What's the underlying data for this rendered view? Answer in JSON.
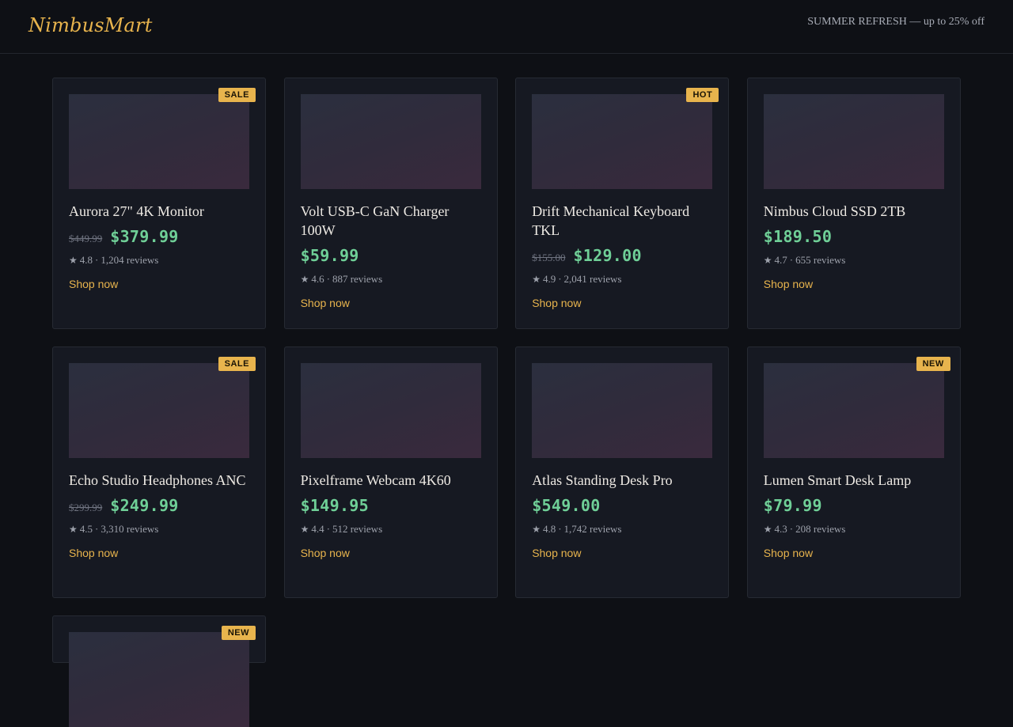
{
  "header": {
    "logo": "NimbusMart",
    "promo": "SUMMER REFRESH — up to 25% off"
  },
  "colors": {
    "accent": "#e8b44d",
    "price": "#6fcf97",
    "background": "#0e1015",
    "card": "#161922"
  },
  "products": [
    {
      "name": "Aurora 27\" 4K Monitor",
      "old_price": "$449.99",
      "price": "$379.99",
      "rating": "4.8",
      "reviews": "1,204 reviews",
      "badge": "SALE",
      "cta": "Shop now"
    },
    {
      "name": "Volt USB-C GaN Charger 100W",
      "old_price": "",
      "price": "$59.99",
      "rating": "4.6",
      "reviews": "887 reviews",
      "badge": "",
      "cta": "Shop now"
    },
    {
      "name": "Drift Mechanical Keyboard TKL",
      "old_price": "$155.00",
      "price": "$129.00",
      "rating": "4.9",
      "reviews": "2,041 reviews",
      "badge": "HOT",
      "cta": "Shop now"
    },
    {
      "name": "Nimbus Cloud SSD 2TB",
      "old_price": "",
      "price": "$189.50",
      "rating": "4.7",
      "reviews": "655 reviews",
      "badge": "",
      "cta": "Shop now"
    },
    {
      "name": "Echo Studio Headphones ANC",
      "old_price": "$299.99",
      "price": "$249.99",
      "rating": "4.5",
      "reviews": "3,310 reviews",
      "badge": "SALE",
      "cta": "Shop now"
    },
    {
      "name": "Pixelframe Webcam 4K60",
      "old_price": "",
      "price": "$149.95",
      "rating": "4.4",
      "reviews": "512 reviews",
      "badge": "",
      "cta": "Shop now"
    },
    {
      "name": "Atlas Standing Desk Pro",
      "old_price": "",
      "price": "$549.00",
      "rating": "4.8",
      "reviews": "1,742 reviews",
      "badge": "",
      "cta": "Shop now"
    },
    {
      "name": "Lumen Smart Desk Lamp",
      "old_price": "",
      "price": "$79.99",
      "rating": "4.3",
      "reviews": "208 reviews",
      "badge": "NEW",
      "cta": "Shop now"
    },
    {
      "name": "",
      "old_price": "",
      "price": "",
      "rating": "",
      "reviews": "",
      "badge": "NEW",
      "cta": ""
    }
  ]
}
